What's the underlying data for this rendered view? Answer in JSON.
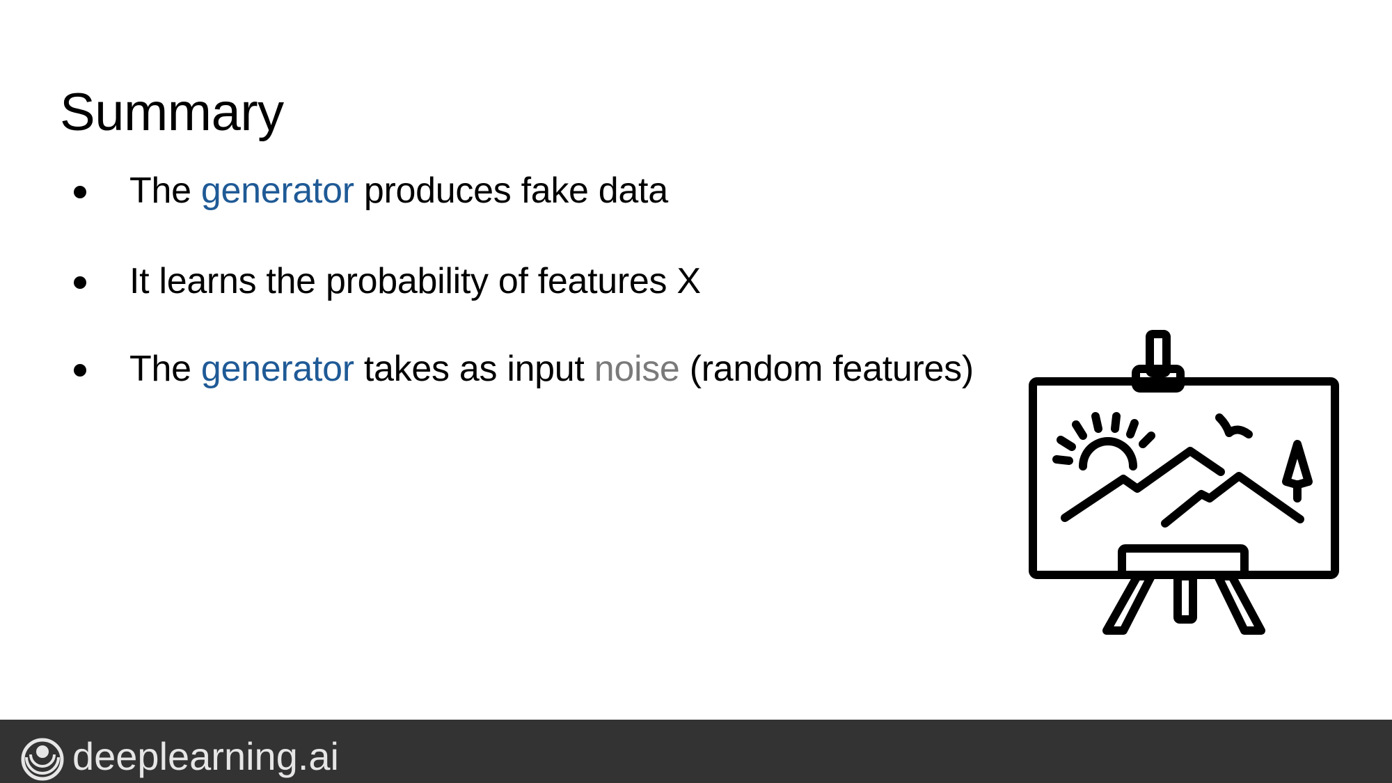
{
  "slide": {
    "title": "Summary"
  },
  "bullets": [
    {
      "parts": [
        {
          "text": "The ",
          "style": "normal"
        },
        {
          "text": "generator",
          "style": "blue"
        },
        {
          "text": " produces fake data",
          "style": "normal"
        }
      ]
    },
    {
      "parts": [
        {
          "text": "It learns the probability of features X",
          "style": "normal"
        }
      ]
    },
    {
      "parts": [
        {
          "text": "The ",
          "style": "normal"
        },
        {
          "text": "generator",
          "style": "blue"
        },
        {
          "text": " takes as input ",
          "style": "normal"
        },
        {
          "text": "noise",
          "style": "gray"
        },
        {
          "text": " (random features)",
          "style": "normal"
        }
      ]
    }
  ],
  "illustration": {
    "icon": "easel-landscape-painting-icon"
  },
  "footer": {
    "brand": "deeplearning.ai",
    "logo_icon": "deeplearning-logo-icon",
    "background_color": "#333333"
  },
  "colors": {
    "highlight_blue": "#1f5a96",
    "highlight_gray": "#7a7a7a"
  }
}
